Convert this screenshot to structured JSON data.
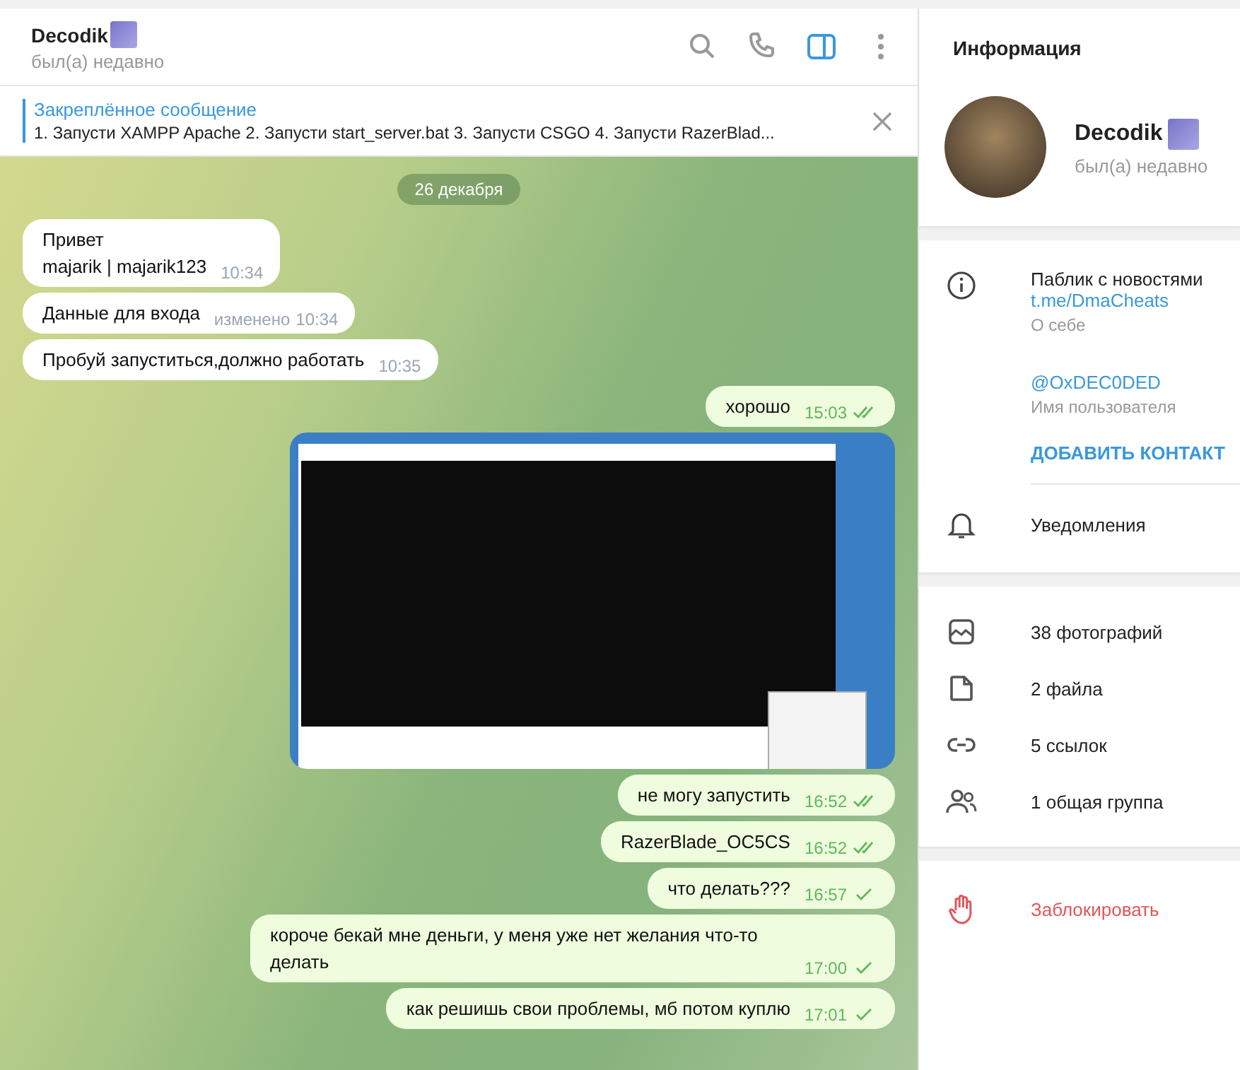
{
  "chat_header": {
    "name": "Decodik",
    "status": "был(а) недавно",
    "actions": [
      {
        "kind": "search",
        "selected": false
      },
      {
        "kind": "call",
        "selected": false
      },
      {
        "kind": "sidebar",
        "selected": true
      },
      {
        "kind": "more",
        "selected": false
      }
    ]
  },
  "pinned": {
    "title": "Закреплённое сообщение",
    "text": "1. Запусти XAMPP Apache 2. Запусти start_server.bat 3. Запусти CSGO 4. Запусти  RazerBlad..."
  },
  "date_badge": "26 декабря",
  "messages": [
    {
      "kind": "text",
      "outgoing": false,
      "text": "Привет\nmajarik | majarik123",
      "time": "10:34"
    },
    {
      "kind": "text",
      "outgoing": false,
      "text": "Данные для входа",
      "edited_label": "изменено",
      "time": "10:34"
    },
    {
      "kind": "text",
      "outgoing": false,
      "text": "Пробуй запуститься,должно работать",
      "time": "10:35"
    },
    {
      "kind": "text",
      "outgoing": true,
      "text": "хорошо",
      "time": "15:03",
      "read": true
    },
    {
      "kind": "photo",
      "outgoing": true
    },
    {
      "kind": "text",
      "outgoing": true,
      "text": "не могу запустить",
      "time": "16:52",
      "read": true
    },
    {
      "kind": "text",
      "outgoing": true,
      "text": "RazerBlade_OC5CS",
      "time": "16:52",
      "read": true
    },
    {
      "kind": "text",
      "outgoing": true,
      "text": "что делать???",
      "time": "16:57",
      "read": false
    },
    {
      "kind": "text",
      "outgoing": true,
      "text": "короче бекай мне деньги, у меня уже нет желания что-то делать",
      "time": "17:00",
      "read": false
    },
    {
      "kind": "text",
      "outgoing": true,
      "text": "как решишь свои проблемы, мб потом куплю",
      "time": "17:01",
      "read": false
    }
  ],
  "info_panel": {
    "title": "Информация",
    "name": "Decodik",
    "status": "был(а) недавно",
    "about": {
      "text": "Паблик с новостями",
      "link": "t.me/DmaCheats",
      "label": "О себе"
    },
    "username": {
      "value": "@OxDEC0DED",
      "label": "Имя пользователя"
    },
    "add_contact": "ДОБАВИТЬ КОНТАКТ",
    "notifications": "Уведомления",
    "media": [
      {
        "kind": "photos",
        "label": "38 фотографий"
      },
      {
        "kind": "files",
        "label": "2 файла"
      },
      {
        "kind": "links",
        "label": "5 ссылок"
      },
      {
        "kind": "groups",
        "label": "1 общая группа"
      }
    ],
    "block": "Заблокировать"
  }
}
